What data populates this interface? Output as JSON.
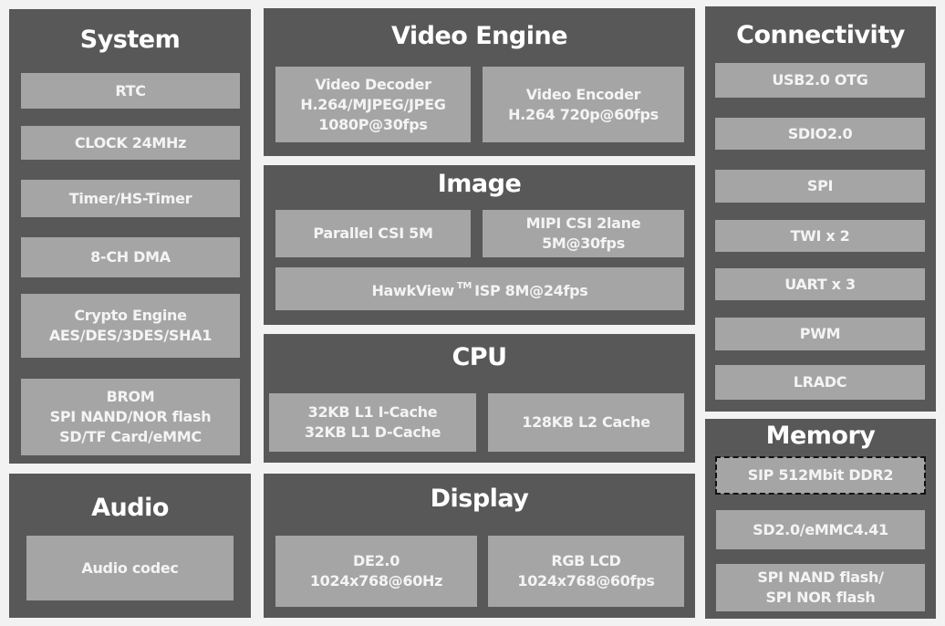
{
  "diagram": "SoC block diagram",
  "system": {
    "title": "System",
    "blocks": [
      {
        "lines": [
          "RTC"
        ]
      },
      {
        "lines": [
          "CLOCK 24MHz"
        ]
      },
      {
        "lines": [
          "Timer/HS-Timer"
        ]
      },
      {
        "lines": [
          "8-CH DMA"
        ]
      },
      {
        "lines": [
          "Crypto Engine",
          "AES/DES/3DES/SHA1"
        ]
      },
      {
        "lines": [
          "BROM",
          "SPI NAND/NOR flash",
          "SD/TF Card/eMMC"
        ]
      }
    ]
  },
  "audio": {
    "title": "Audio",
    "blocks": [
      {
        "lines": [
          "Audio codec"
        ]
      }
    ]
  },
  "video_engine": {
    "title": "Video Engine",
    "blocks": [
      {
        "lines": [
          "Video Decoder",
          "H.264/MJPEG/JPEG",
          "1080P@30fps"
        ]
      },
      {
        "lines": [
          "Video Encoder",
          "H.264 720p@60fps"
        ]
      }
    ]
  },
  "image": {
    "title": "Image",
    "blocks": [
      {
        "lines": [
          "Parallel CSI 5M"
        ]
      },
      {
        "lines": [
          "MIPI CSI  2lane",
          "5M@30fps"
        ]
      },
      {
        "prefix": "HawkView",
        "superscript": "TM",
        "suffix": "ISP 8M@24fps"
      }
    ]
  },
  "cpu": {
    "title": "CPU",
    "blocks": [
      {
        "lines": [
          "32KB L1 I-Cache",
          "32KB L1 D-Cache"
        ]
      },
      {
        "lines": [
          "128KB L2 Cache"
        ]
      }
    ]
  },
  "display": {
    "title": "Display",
    "blocks": [
      {
        "lines": [
          "DE2.0",
          "1024x768@60Hz"
        ]
      },
      {
        "lines": [
          "RGB LCD",
          "1024x768@60fps"
        ]
      }
    ]
  },
  "connectivity": {
    "title": "Connectivity",
    "blocks": [
      {
        "lines": [
          "USB2.0 OTG"
        ]
      },
      {
        "lines": [
          "SDIO2.0"
        ]
      },
      {
        "lines": [
          "SPI"
        ]
      },
      {
        "lines": [
          "TWI x 2"
        ]
      },
      {
        "lines": [
          "UART x 3"
        ]
      },
      {
        "lines": [
          "PWM"
        ]
      },
      {
        "lines": [
          "LRADC"
        ]
      }
    ]
  },
  "memory": {
    "title": "Memory",
    "blocks": [
      {
        "lines": [
          "SIP 512Mbit DDR2"
        ],
        "style": "dashed"
      },
      {
        "lines": [
          "SD2.0/eMMC4.41"
        ]
      },
      {
        "lines": [
          "SPI NAND flash/",
          "SPI NOR flash"
        ]
      }
    ]
  },
  "colors": {
    "background": "#f2f2f2",
    "panel": "#585858",
    "block": "#a5a5a5",
    "text": "#ffffff"
  }
}
